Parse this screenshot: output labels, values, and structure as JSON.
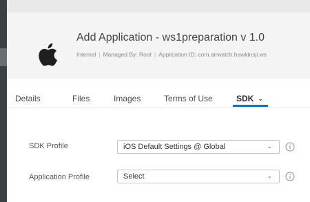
{
  "header": {
    "title": "Add Application - ws1preparation v 1.0",
    "meta": {
      "type": "Internal",
      "managed_by": "Managed By: Root",
      "application_id": "Application ID: com.airwatch.hawkinsji.ws"
    },
    "separator": "|",
    "icon": "apple-logo-icon"
  },
  "tabs": [
    {
      "label": "Details"
    },
    {
      "label": "Files"
    },
    {
      "label": "Images"
    },
    {
      "label": "Terms of Use"
    },
    {
      "label": "SDK",
      "active": true,
      "chevron": "⌄"
    }
  ],
  "form": {
    "sdk_profile": {
      "label": "SDK Profile",
      "value": "iOS Default Settings @ Global",
      "chevron": "⌄",
      "info_icon": "info-circle-icon"
    },
    "application_profile": {
      "label": "Application Profile",
      "value": "Select",
      "chevron": "⌄",
      "info_icon": "info-circle-icon"
    }
  },
  "colors": {
    "accent": "#1a6fb5",
    "header_bg": "#f4f4f4",
    "left_rail": "#3c3f44"
  }
}
